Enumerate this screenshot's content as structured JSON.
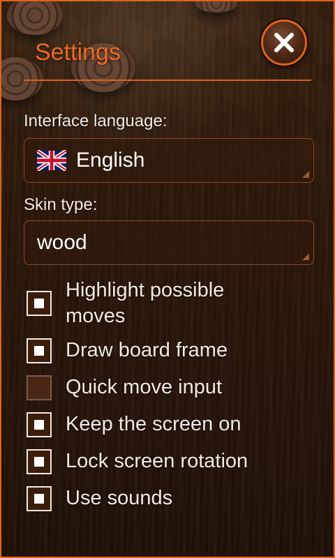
{
  "header": {
    "title": "Settings",
    "close_icon": "close-icon"
  },
  "language": {
    "label": "Interface language:",
    "value": "English",
    "flag_icon": "uk-flag-icon"
  },
  "skin": {
    "label": "Skin type:",
    "value": "wood"
  },
  "options": [
    {
      "label": "Highlight possible moves",
      "checked": true
    },
    {
      "label": "Draw board frame",
      "checked": true
    },
    {
      "label": "Quick move input",
      "checked": false
    },
    {
      "label": "Keep the screen on",
      "checked": true
    },
    {
      "label": "Lock screen rotation",
      "checked": true
    },
    {
      "label": "Use sounds",
      "checked": true
    }
  ],
  "colors": {
    "accent": "#e0621a",
    "title": "#ee6a22",
    "text": "#f2ebe3"
  }
}
